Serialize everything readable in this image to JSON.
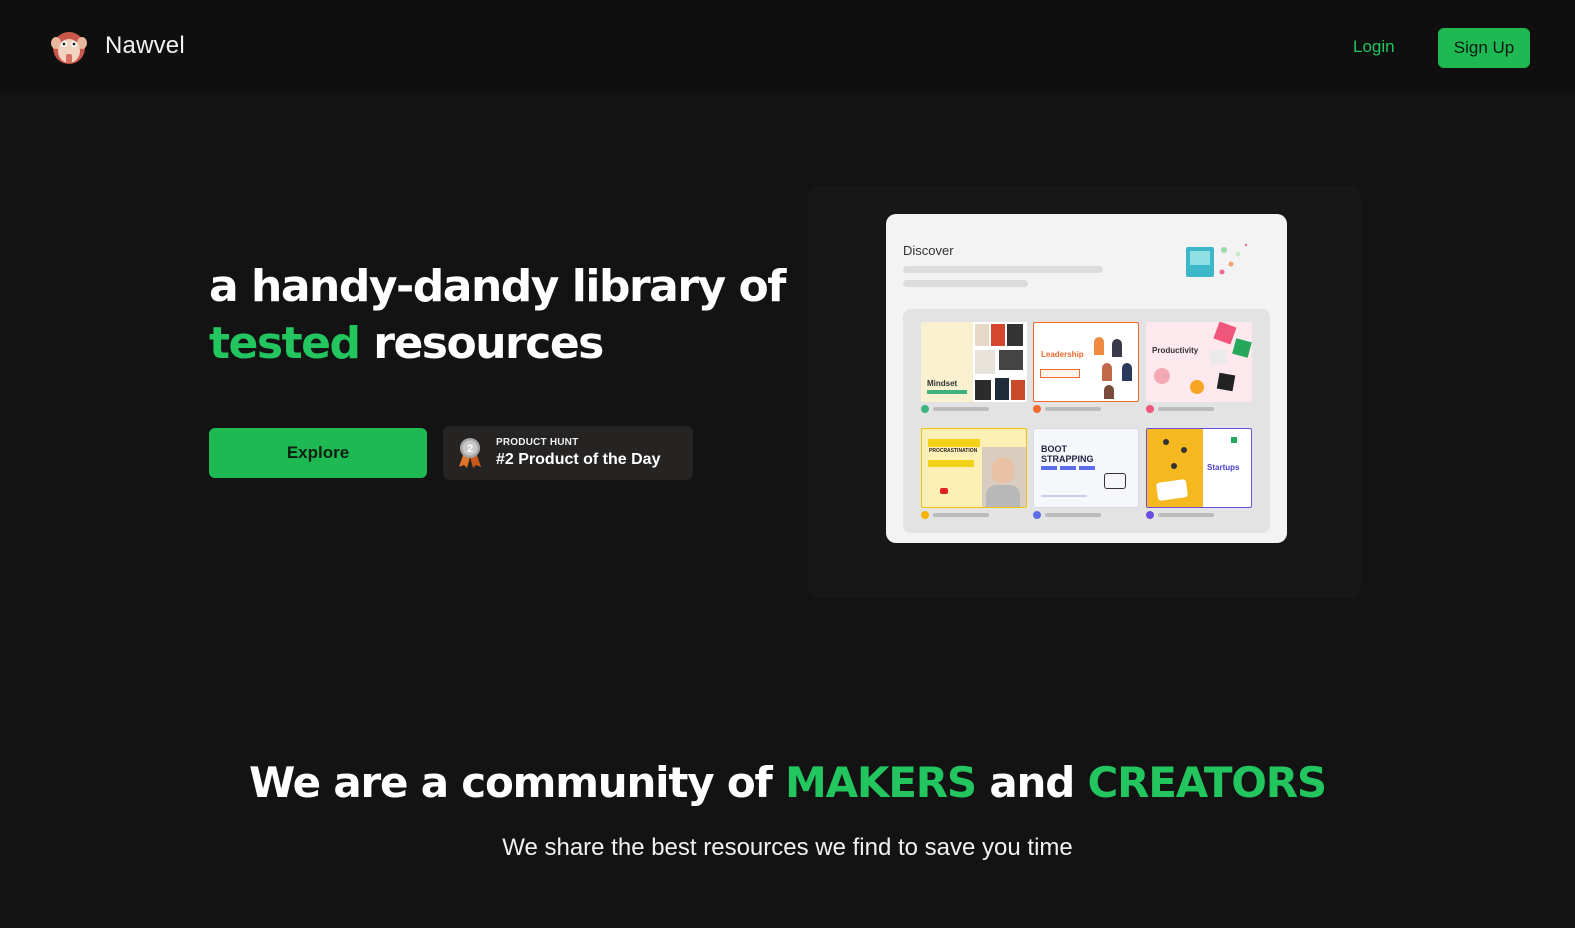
{
  "nav": {
    "brand": "Nawvel",
    "login_label": "Login",
    "signup_label": "Sign Up"
  },
  "hero": {
    "headline_part1": "a handy-dandy library of",
    "headline_green": "tested",
    "headline_part2": "resources",
    "explore_label": "Explore",
    "badge_small": "PRODUCT HUNT",
    "badge_big": "#2 Product of the Day",
    "badge_medal_number": "2"
  },
  "mockup": {
    "title": "Discover",
    "tiles": [
      {
        "label": "Mindset",
        "dot": "#3fb37f"
      },
      {
        "label": "Leadership",
        "dot": "#f06a2e"
      },
      {
        "label": "Productivity",
        "dot": "#f0567a"
      },
      {
        "label": "PROCRASTINATION",
        "dot": "#f4b400"
      },
      {
        "label": "BOOT STRAPPING",
        "dot": "#5b6ee8"
      },
      {
        "label": "Startups",
        "dot": "#6a4de0"
      }
    ]
  },
  "community": {
    "part1": "We are a community of",
    "makers": "MAKERS",
    "and": "and",
    "creators": "CREATORS",
    "subline": "We share the best resources we find to save you time"
  },
  "colors": {
    "accent": "#1fb954",
    "background": "#131313",
    "nav_background": "#0f0f0f"
  }
}
